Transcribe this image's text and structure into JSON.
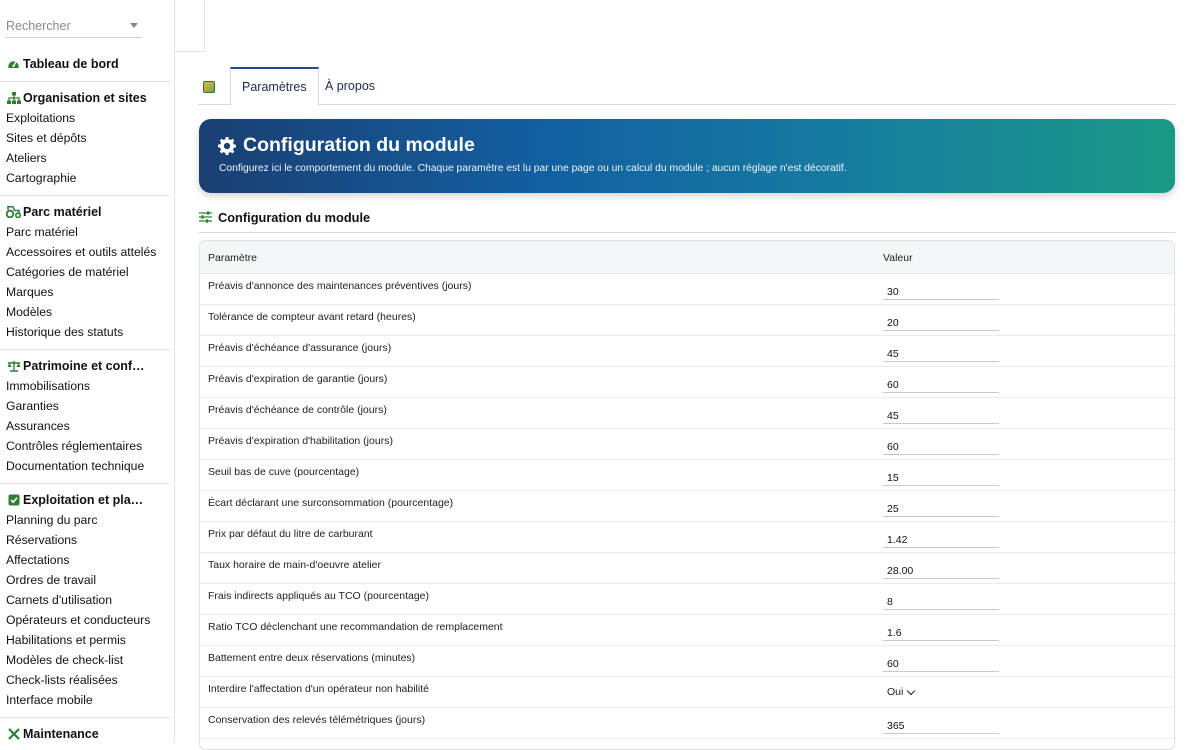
{
  "search": {
    "placeholder": "Rechercher"
  },
  "sidebar": {
    "dashboard": "Tableau de bord",
    "sections": [
      {
        "title": "Organisation et sites",
        "icon": "sitemap-icon",
        "items": [
          "Exploitations",
          "Sites et dépôts",
          "Ateliers",
          "Cartographie"
        ]
      },
      {
        "title": "Parc matériel",
        "icon": "tractor-icon",
        "items": [
          "Parc matériel",
          "Accessoires et outils attelés",
          "Catégories de matériel",
          "Marques",
          "Modèles",
          "Historique des statuts"
        ]
      },
      {
        "title": "Patrimoine et conformité",
        "icon": "scale-icon",
        "items": [
          "Immobilisations",
          "Garanties",
          "Assurances",
          "Contrôles réglementaires",
          "Documentation technique"
        ]
      },
      {
        "title": "Exploitation et planification",
        "icon": "checkbox-icon",
        "items": [
          "Planning du parc",
          "Réservations",
          "Affectations",
          "Ordres de travail",
          "Carnets d'utilisation",
          "Opérateurs et conducteurs",
          "Habilitations et permis",
          "Modèles de check-list",
          "Check-lists réalisées",
          "Interface mobile"
        ]
      },
      {
        "title": "Maintenance",
        "icon": "wrench-icon",
        "items": []
      }
    ]
  },
  "tabs": [
    {
      "label": "Paramètres",
      "active": true
    },
    {
      "label": "À propos",
      "active": false
    }
  ],
  "banner": {
    "title": "Configuration du module",
    "subtitle": "Configurez ici le comportement du module. Chaque paramètre est lu par une page ou un calcul du module ; aucun réglage n'est décoratif."
  },
  "section": {
    "title": "Configuration du module"
  },
  "table": {
    "headers": {
      "param": "Paramètre",
      "value": "Valeur"
    },
    "rows": [
      {
        "label": "Préavis d'annonce des maintenances préventives (jours)",
        "value": "30"
      },
      {
        "label": "Tolérance de compteur avant retard (heures)",
        "value": "20"
      },
      {
        "label": "Préavis d'échéance d'assurance (jours)",
        "value": "45"
      },
      {
        "label": "Préavis d'expiration de garantie (jours)",
        "value": "60"
      },
      {
        "label": "Préavis d'échéance de contrôle (jours)",
        "value": "45"
      },
      {
        "label": "Préavis d'expiration d'habilitation (jours)",
        "value": "60"
      },
      {
        "label": "Seuil bas de cuve (pourcentage)",
        "value": "15"
      },
      {
        "label": "Écart déclarant une surconsommation (pourcentage)",
        "value": "25"
      },
      {
        "label": "Prix par défaut du litre de carburant",
        "value": "1.42"
      },
      {
        "label": "Taux horaire de main-d'oeuvre atelier",
        "value": "28.00"
      },
      {
        "label": "Frais indirects appliqués au TCO (pourcentage)",
        "value": "8"
      },
      {
        "label": "Ratio TCO déclenchant une recommandation de remplacement",
        "value": "1.6"
      },
      {
        "label": "Battement entre deux réservations (minutes)",
        "value": "60"
      },
      {
        "label": "Interdire l'affectation d'un opérateur non habilité",
        "value": "Oui",
        "type": "select"
      },
      {
        "label": "Conservation des relevés télémétriques (jours)",
        "value": "365"
      }
    ]
  },
  "colors": {
    "accent": "#1e4b8f",
    "banner_start": "#1a3f73",
    "banner_end": "#1a9a86",
    "icon_green": "#2e7d32"
  }
}
